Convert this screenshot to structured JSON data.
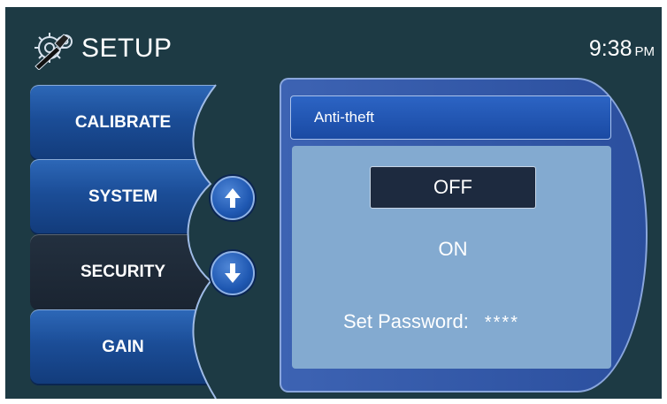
{
  "header": {
    "title": "SETUP",
    "icon": "gear-wrench-icon",
    "time": "9:38",
    "ampm": "PM"
  },
  "menu": {
    "items": [
      {
        "label": "CALIBRATE",
        "active": false
      },
      {
        "label": "SYSTEM",
        "active": false
      },
      {
        "label": "SECURITY",
        "active": true
      },
      {
        "label": "GAIN",
        "active": false
      }
    ],
    "scroll_up_icon": "arrow-up-icon",
    "scroll_down_icon": "arrow-down-icon"
  },
  "panel": {
    "title": "Anti-theft",
    "options": [
      {
        "label": "OFF",
        "selected": true
      },
      {
        "label": "ON",
        "selected": false
      }
    ],
    "password_label": "Set Password:",
    "password_value": "****"
  },
  "colors": {
    "background": "#1d3a44",
    "menu_blue": "#1b4d97",
    "menu_active": "#1a2431",
    "panel_body": "#83aad0",
    "panel_header": "#1a4aa3"
  }
}
